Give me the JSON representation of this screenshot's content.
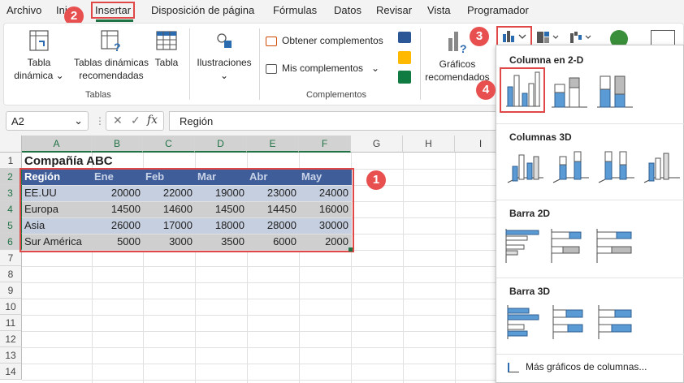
{
  "menu": {
    "items": [
      "Archivo",
      "Ini",
      "Insertar",
      "Disposición de página",
      "Fórmulas",
      "Datos",
      "Revisar",
      "Vista",
      "Programador"
    ]
  },
  "ribbon": {
    "tabla_dinamica": "Tabla",
    "tabla_dinamica_2": "dinámica",
    "tablas_recomendadas": "Tablas dinámicas",
    "tablas_recomendadas_2": "recomendadas",
    "tabla": "Tabla",
    "ilustraciones": "Ilustraciones",
    "obtener": "Obtener complementos",
    "mis": "Mis complementos",
    "graficos": "Gráficos",
    "graficos_2": "recomendados",
    "group_tablas": "Tablas",
    "group_complementos": "Complementos"
  },
  "formula_bar": {
    "name_box": "A2",
    "formula": "Región"
  },
  "grid": {
    "columns": [
      "A",
      "B",
      "C",
      "D",
      "E",
      "F",
      "G",
      "H",
      "I"
    ],
    "rows": [
      "1",
      "2",
      "3",
      "4",
      "5",
      "6",
      "7",
      "8",
      "9",
      "10",
      "11",
      "12",
      "13",
      "14"
    ],
    "title": "Compañía ABC",
    "headers": [
      "Región",
      "Ene",
      "Feb",
      "Mar",
      "Abr",
      "May"
    ],
    "data": [
      [
        "EE.UU",
        "20000",
        "22000",
        "19000",
        "23000",
        "24000"
      ],
      [
        "Europa",
        "14500",
        "14600",
        "14500",
        "14450",
        "16000"
      ],
      [
        "Asia",
        "26000",
        "17000",
        "18000",
        "28000",
        "30000"
      ],
      [
        "Sur América",
        "5000",
        "3000",
        "3500",
        "6000",
        "2000"
      ]
    ]
  },
  "dropdown": {
    "col2d": "Columna en 2-D",
    "col3d": "Columnas 3D",
    "bar2d": "Barra 2D",
    "bar3d": "Barra 3D",
    "more": "Más gráficos de columnas..."
  },
  "badges": [
    "1",
    "2",
    "3",
    "4"
  ],
  "colors": {
    "accent": "#217346",
    "table_header": "#4472c4",
    "selected_fill": "#a6b3c9",
    "badge": "#e84f4f",
    "chart_blue": "#5b9bd5"
  }
}
